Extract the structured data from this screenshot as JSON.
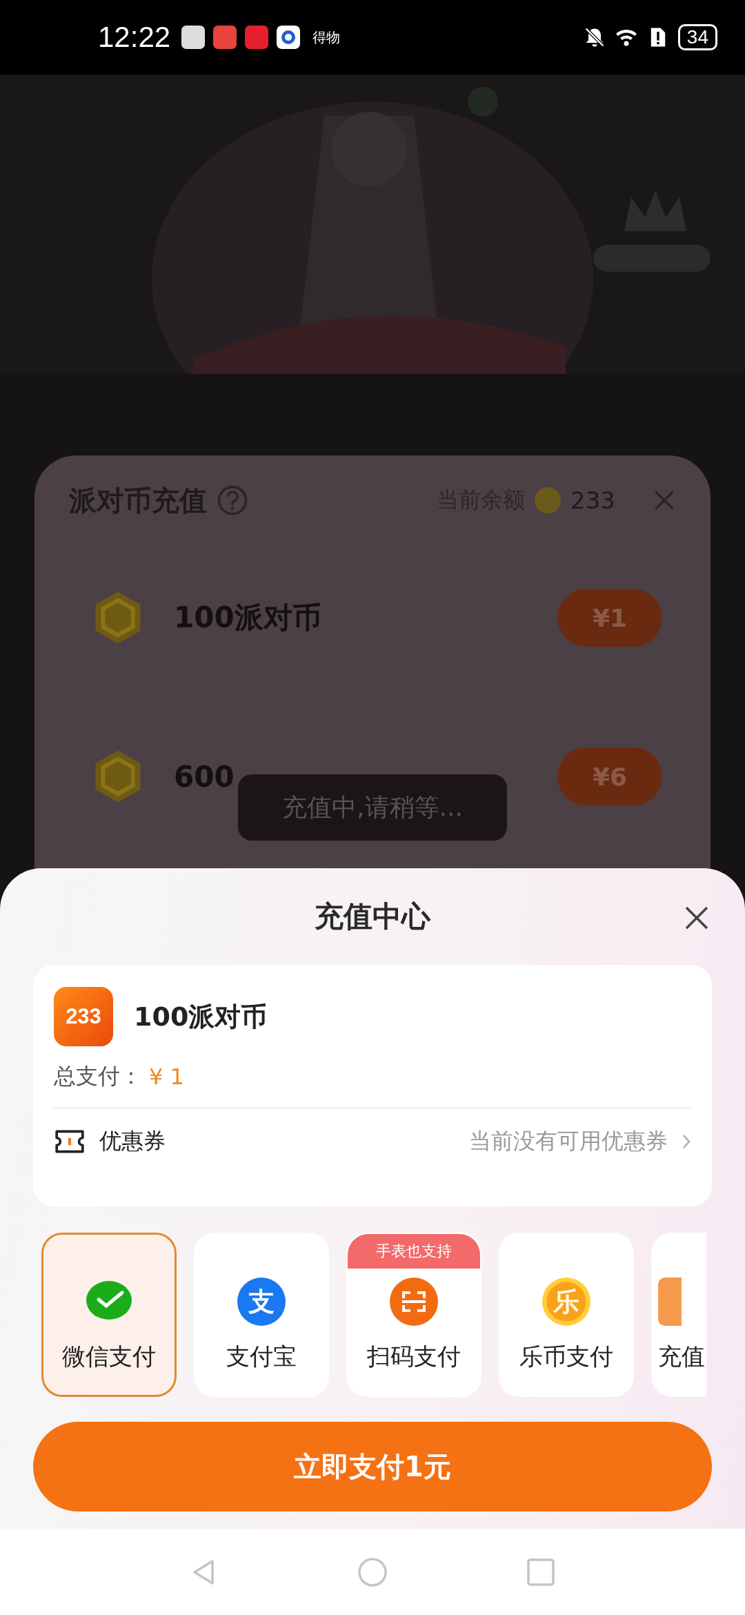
{
  "status_bar": {
    "time": "12:22",
    "app_label": "得物",
    "battery": "34"
  },
  "background_panel": {
    "title": "派对币充值",
    "balance_label": "当前余额",
    "balance": "233",
    "packages": [
      {
        "name": "100派对币",
        "price": "¥1"
      },
      {
        "name": "600",
        "price": "¥6"
      }
    ]
  },
  "toast": "充值中,请稍等...",
  "sheet": {
    "title": "充值中心",
    "product": {
      "logo": "233",
      "name": "100派对币",
      "total_label": "总支付：",
      "total": "¥ 1"
    },
    "coupon": {
      "label": "优惠券",
      "value": "当前没有可用优惠券"
    },
    "methods": [
      {
        "kind": "wechat",
        "label": "微信支付",
        "selected": true
      },
      {
        "kind": "alipay",
        "label": "支付宝",
        "glyph": "支",
        "selected": false
      },
      {
        "kind": "scan",
        "label": "扫码支付",
        "badge": "手表也支持",
        "selected": false
      },
      {
        "kind": "lecoin",
        "label": "乐币支付",
        "glyph": "乐",
        "selected": false
      },
      {
        "kind": "partial",
        "label": "充值",
        "selected": false
      }
    ],
    "pay_button": "立即支付1元"
  }
}
